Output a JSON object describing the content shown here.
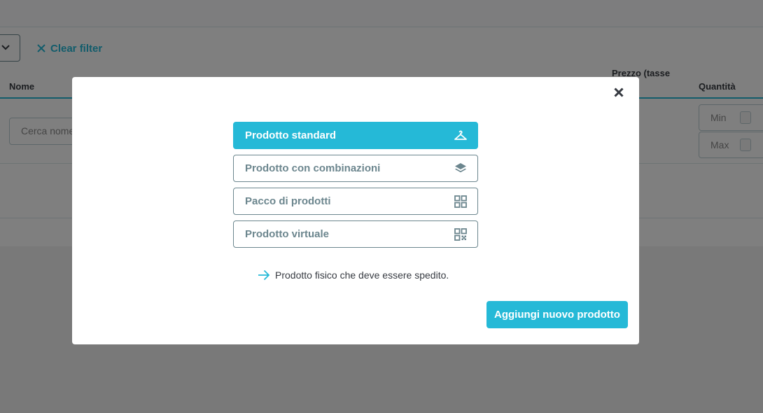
{
  "filters": {
    "clear_filter_label": "Clear filter"
  },
  "table": {
    "headers": {
      "nome": "Nome",
      "prezzo": "Prezzo (tasse",
      "quantita": "Quantità"
    },
    "search_nome_placeholder": "Cerca nome",
    "quantity_min_placeholder": "Min",
    "quantity_max_placeholder": "Max"
  },
  "modal": {
    "product_types": [
      {
        "label": "Prodotto standard",
        "icon": "hanger-icon",
        "selected": true
      },
      {
        "label": "Prodotto con combinazioni",
        "icon": "layers-icon",
        "selected": false
      },
      {
        "label": "Pacco di prodotti",
        "icon": "grid-icon",
        "selected": false
      },
      {
        "label": "Prodotto virtuale",
        "icon": "qr-code-icon",
        "selected": false
      }
    ],
    "description": "Prodotto fisico che deve essere spedito.",
    "add_button_label": "Aggiungi nuovo prodotto"
  },
  "colors": {
    "accent": "#25b9d7",
    "border": "#6c868e",
    "text": "#363a41"
  }
}
